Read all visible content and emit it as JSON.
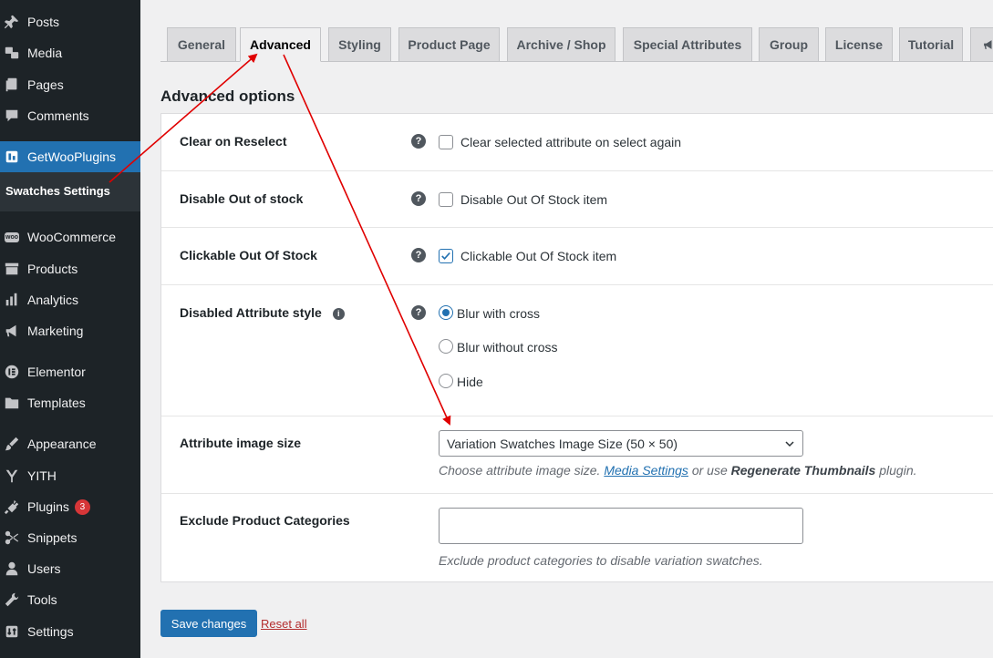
{
  "sidebar": {
    "items": [
      {
        "label": "Posts",
        "icon": "pin-icon"
      },
      {
        "label": "Media",
        "icon": "media-icon"
      },
      {
        "label": "Pages",
        "icon": "pages-icon"
      },
      {
        "label": "Comments",
        "icon": "comment-icon"
      },
      {
        "label": "GetWooPlugins",
        "icon": "plugin-logo-icon"
      },
      {
        "label": "WooCommerce",
        "icon": "woo-icon"
      },
      {
        "label": "Products",
        "icon": "archive-icon"
      },
      {
        "label": "Analytics",
        "icon": "bar-chart-icon"
      },
      {
        "label": "Marketing",
        "icon": "megaphone-icon"
      },
      {
        "label": "Elementor",
        "icon": "elementor-icon"
      },
      {
        "label": "Templates",
        "icon": "folder-icon"
      },
      {
        "label": "Appearance",
        "icon": "brush-icon"
      },
      {
        "label": "YITH",
        "icon": "yith-icon"
      },
      {
        "label": "Plugins",
        "icon": "plug-icon",
        "badge": "3"
      },
      {
        "label": "Snippets",
        "icon": "scissors-icon"
      },
      {
        "label": "Users",
        "icon": "user-icon"
      },
      {
        "label": "Tools",
        "icon": "wrench-icon"
      },
      {
        "label": "Settings",
        "icon": "settings-icon"
      }
    ],
    "submenu_label": "Swatches Settings",
    "woo_logo_text": "woo"
  },
  "tabs": [
    "General",
    "Advanced",
    "Styling",
    "Product Page",
    "Archive / Shop",
    "Special Attributes",
    "Group",
    "License",
    "Tutorial"
  ],
  "active_tab": "Advanced",
  "section_title": "Advanced options",
  "help_glyph": "?",
  "info_glyph": "i",
  "options": {
    "clear_on_reselect": {
      "label": "Clear on Reselect",
      "text": "Clear selected attribute on select again",
      "checked": false
    },
    "disable_out_of_stock": {
      "label": "Disable Out of stock",
      "text": "Disable Out Of Stock item",
      "checked": false
    },
    "clickable_out_of_stock": {
      "label": "Clickable Out Of Stock",
      "text": "Clickable Out Of Stock item",
      "checked": true
    },
    "disabled_attribute_style": {
      "label": "Disabled Attribute style",
      "choices": [
        "Blur with cross",
        "Blur without cross",
        "Hide"
      ],
      "selected": "Blur with cross"
    },
    "attribute_image_size": {
      "label": "Attribute image size",
      "value": "Variation Swatches Image Size (50 × 50)",
      "desc_prefix": "Choose attribute image size.",
      "desc_link": "Media Settings",
      "desc_mid": "or use",
      "desc_bold": "Regenerate Thumbnails",
      "desc_suffix": "plugin."
    },
    "exclude_categories": {
      "label": "Exclude Product Categories",
      "value": "",
      "desc": "Exclude product categories to disable variation swatches."
    }
  },
  "buttons": {
    "save": "Save changes",
    "reset": "Reset all"
  },
  "colors": {
    "sidebar_bg": "#1d2327",
    "accent": "#2271b1",
    "badge": "#d63638",
    "annotation_arrow": "#e00000"
  }
}
